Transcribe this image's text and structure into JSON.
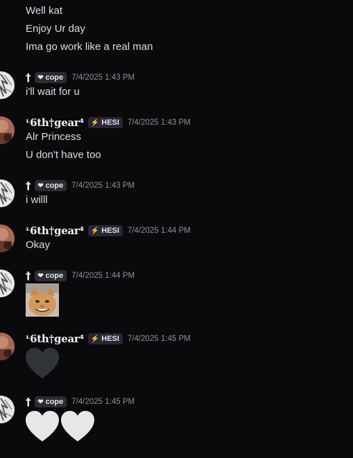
{
  "users": {
    "cross": {
      "name": "†",
      "tag": "cope"
    },
    "sixth": {
      "name": "ᶫ6th†gear⁴",
      "tag": "HESI"
    }
  },
  "icons": {
    "cope_tag": "heart-icon",
    "hesi_tag": "lightning-icon",
    "emoji_white": "white-heart-emoji",
    "emoji_black": "black-heart-emoji",
    "sticker": "smiling-cat-sticker"
  },
  "colors": {
    "background": "#0a0a0c",
    "text": "#dbdee1",
    "timestamp": "#8e9297",
    "hesi_accent": "#a46cff"
  },
  "messages": {
    "lead": [
      "Well kat",
      "Enjoy Ur day",
      "Ima go work like a real man"
    ],
    "g1": {
      "timestamp": "7/4/2025 1:43 PM",
      "lines": [
        "i'll wait for u"
      ]
    },
    "g2": {
      "timestamp": "7/4/2025 1:43 PM",
      "lines": [
        "Alr Princess",
        "U don't have too"
      ]
    },
    "g3": {
      "timestamp": "7/4/2025 1:43 PM",
      "lines": [
        "i willl"
      ]
    },
    "g4": {
      "timestamp": "7/4/2025 1:44 PM",
      "lines": [
        "Okay"
      ]
    },
    "g5": {
      "timestamp": "7/4/2025 1:44 PM"
    },
    "g6": {
      "timestamp": "7/4/2025 1:45 PM"
    },
    "g7": {
      "timestamp": "7/4/2025 1:45 PM"
    }
  }
}
